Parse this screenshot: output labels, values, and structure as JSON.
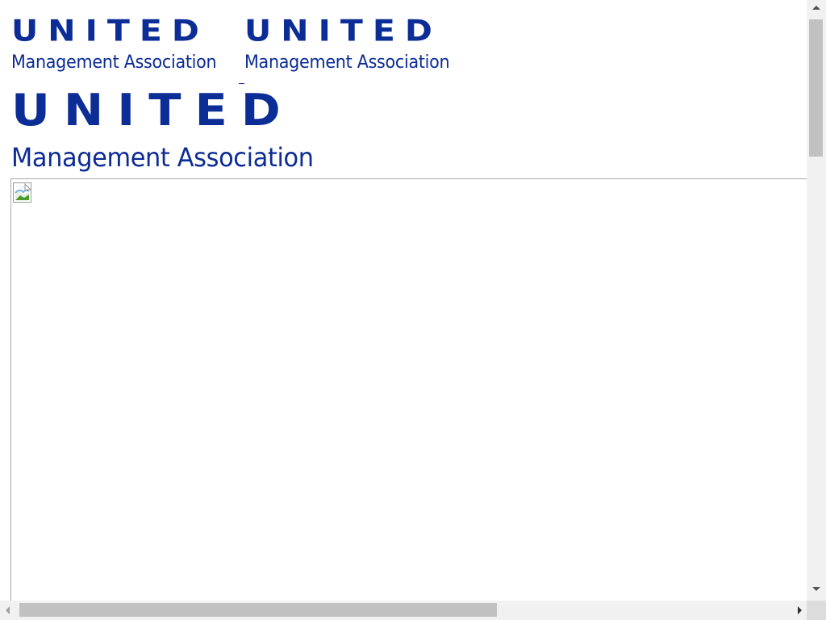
{
  "logos": {
    "brand_color": "#0c2c96",
    "first": {
      "word": "UNITED",
      "subtitle": "Management Association"
    },
    "second": {
      "word": "UNITED",
      "subtitle": "Management Association"
    },
    "large": {
      "word": "UNITED",
      "subtitle": "Management Association"
    }
  },
  "embedded_frame": {
    "image": {
      "icon": "broken-image-icon",
      "state": "failed-to-load"
    }
  },
  "scrollbars": {
    "vertical": {
      "thumb_position": 0.0,
      "thumb_fraction": 0.23
    },
    "horizontal": {
      "thumb_position": 0.0,
      "thumb_fraction": 0.59
    }
  }
}
